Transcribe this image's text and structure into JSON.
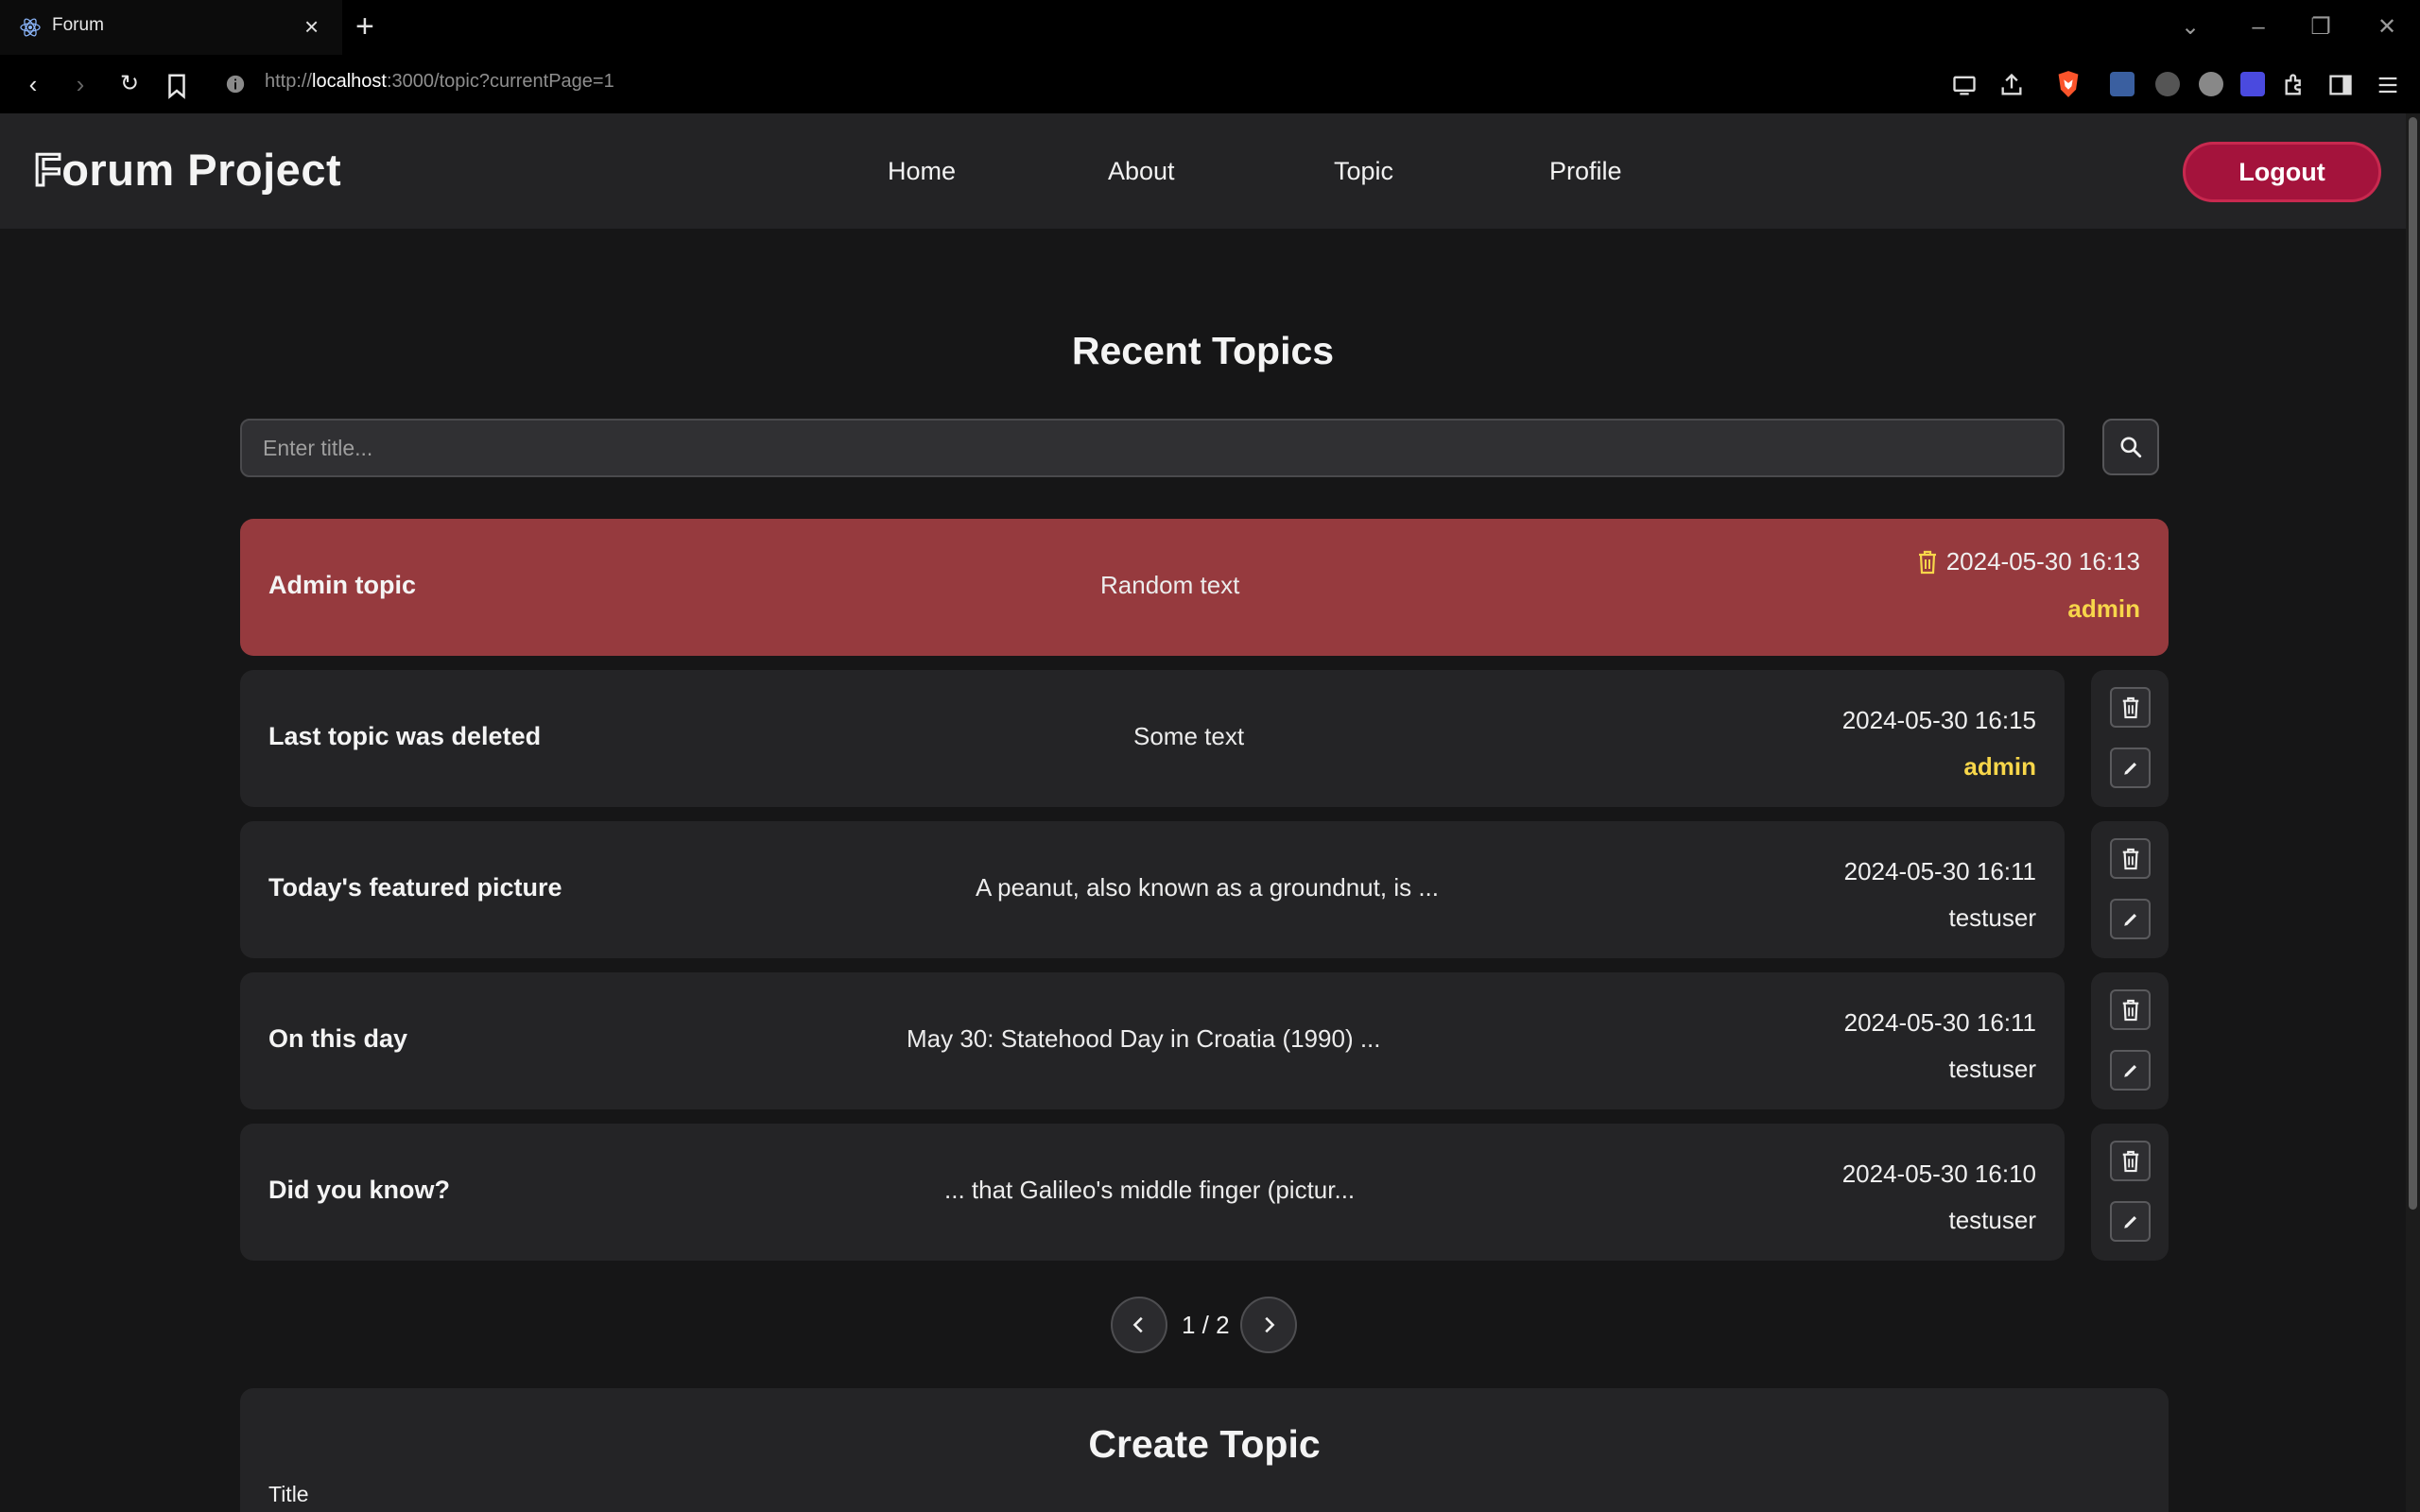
{
  "browser": {
    "tab_title": "Forum",
    "url_prefix": "http://",
    "url_host": "localhost",
    "url_rest": ":3000/topic?currentPage=1"
  },
  "app": {
    "logo_first": "F",
    "logo_rest": "orum Project",
    "nav": [
      "Home",
      "About",
      "Topic",
      "Profile"
    ],
    "logout_label": "Logout"
  },
  "main": {
    "title": "Recent Topics",
    "search_placeholder": "Enter title..."
  },
  "topics": [
    {
      "title": "Admin topic",
      "body": "Random text",
      "date": "2024-05-30 16:13",
      "author": "admin"
    },
    {
      "title": "Last topic was deleted",
      "body": "Some text",
      "date": "2024-05-30 16:15",
      "author": "admin"
    },
    {
      "title": "Today's featured picture",
      "body": "A peanut, also known as a groundnut, is ...",
      "date": "2024-05-30 16:11",
      "author": "testuser"
    },
    {
      "title": "On this day",
      "body": "May 30: Statehood Day in Croatia (1990) ...",
      "date": "2024-05-30 16:11",
      "author": "testuser"
    },
    {
      "title": "Did you know?",
      "body": "... that Galileo's middle finger (pictur...",
      "date": "2024-05-30 16:10",
      "author": "testuser"
    }
  ],
  "pagination": {
    "label": "1 / 2"
  },
  "create": {
    "title": "Create Topic",
    "title_label": "Title"
  },
  "colors": {
    "accent": "#a4133c",
    "highlight": "#963a3e",
    "admin": "#f7d64a"
  }
}
